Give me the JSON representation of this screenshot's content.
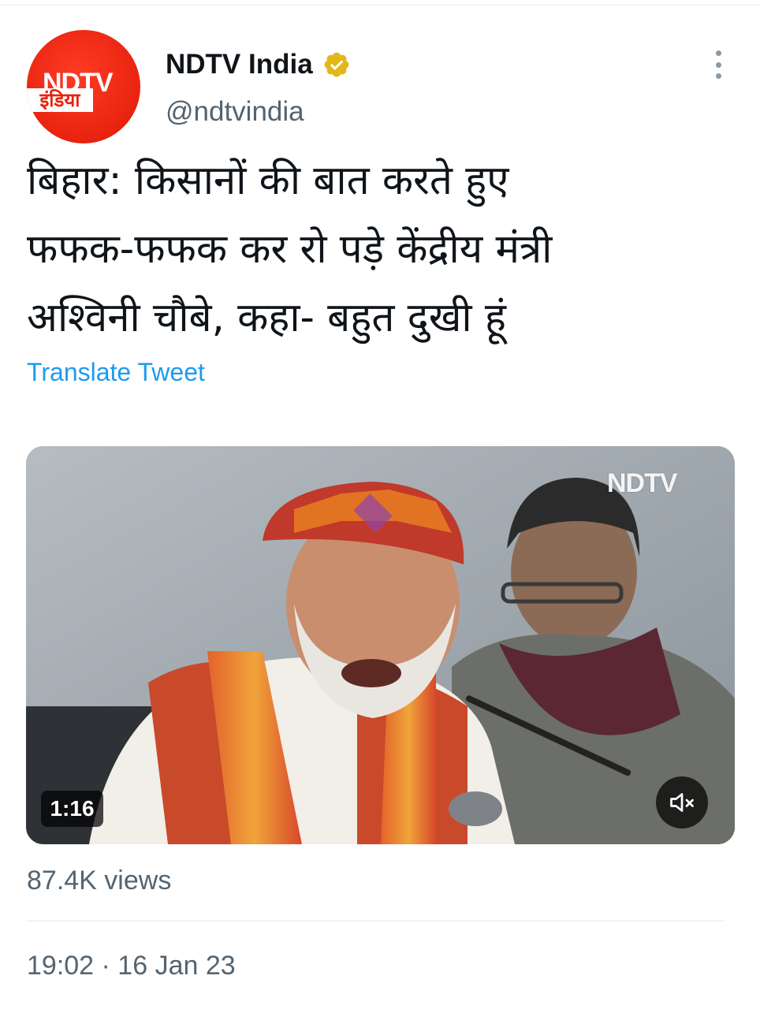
{
  "account": {
    "display_name": "NDTV India",
    "handle": "@ndtvindia",
    "avatar_logo": "NDTV",
    "avatar_logo_hindi": "इंडिया",
    "verified_color": "#e2b719",
    "more_icon": "more-vertical-icon"
  },
  "tweet": {
    "text_lines": [
      "बिहार: किसानों की बात करते हुए",
      "फफक-फफक कर रो पड़े केंद्रीय मंत्री",
      "अश्विनी चौबे, कहा- बहुत दुखी हूं"
    ],
    "translate_label": "Translate Tweet",
    "accent_color": "#1d9bf0"
  },
  "media": {
    "watermark": "NDTV",
    "duration": "1:16",
    "mute_icon": "speaker-muted-icon"
  },
  "stats": {
    "views": "87.4K views",
    "timestamp": "19:02 · 16 Jan 23"
  }
}
